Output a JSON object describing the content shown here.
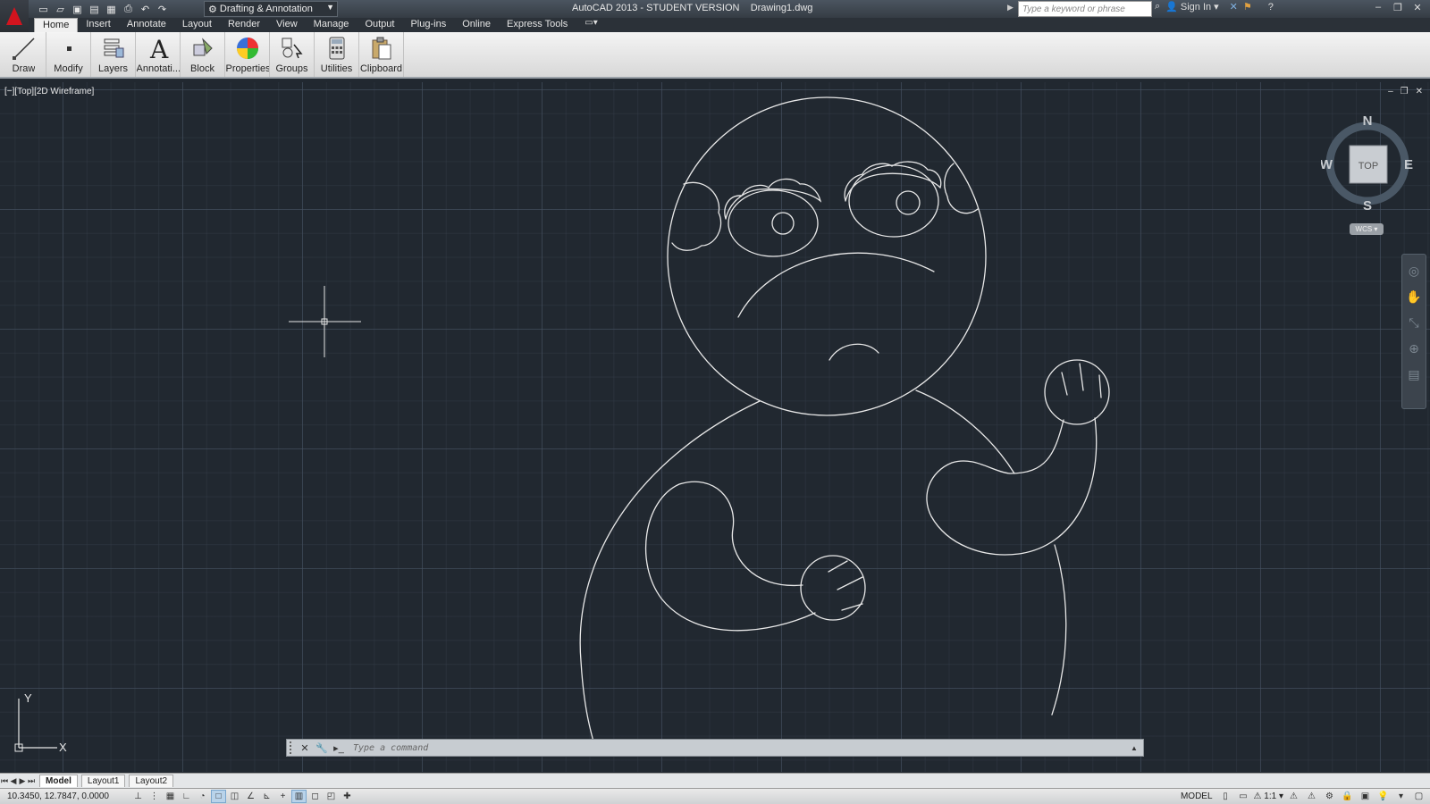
{
  "titlebar": {
    "workspace": "Drafting & Annotation",
    "window_title": "AutoCAD 2013 - STUDENT VERSION    Drawing1.dwg",
    "search_placeholder": "Type a keyword or phrase",
    "sign_in": "Sign In"
  },
  "ribbon": {
    "tabs": [
      {
        "label": "Home"
      },
      {
        "label": "Insert"
      },
      {
        "label": "Annotate"
      },
      {
        "label": "Layout"
      },
      {
        "label": "Render"
      },
      {
        "label": "View"
      },
      {
        "label": "Manage"
      },
      {
        "label": "Output"
      },
      {
        "label": "Plug-ins"
      },
      {
        "label": "Online"
      },
      {
        "label": "Express Tools"
      }
    ],
    "panels": [
      {
        "label": "Draw"
      },
      {
        "label": "Modify"
      },
      {
        "label": "Layers"
      },
      {
        "label": "Annotati..."
      },
      {
        "label": "Block"
      },
      {
        "label": "Properties"
      },
      {
        "label": "Groups"
      },
      {
        "label": "Utilities"
      },
      {
        "label": "Clipboard"
      }
    ]
  },
  "viewport": {
    "label": "[−][Top][2D Wireframe]"
  },
  "viewcube": {
    "north": "N",
    "south": "S",
    "east": "E",
    "west": "W",
    "face": "TOP",
    "wcs": "WCS"
  },
  "ucs": {
    "x": "X",
    "y": "Y"
  },
  "command": {
    "placeholder": "Type a command"
  },
  "layout_tabs": [
    {
      "label": "Model"
    },
    {
      "label": "Layout1"
    },
    {
      "label": "Layout2"
    }
  ],
  "status": {
    "coordinates": "10.3450, 12.7847, 0.0000",
    "model": "MODEL",
    "scale": "1:1"
  },
  "colors": {
    "background": "#212830",
    "linework": "#e8e8e8",
    "accent_red": "#d3141e"
  }
}
